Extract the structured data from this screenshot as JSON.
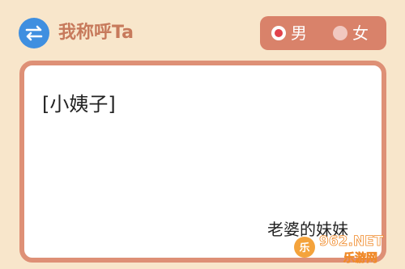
{
  "header": {
    "title": "我称呼Ta",
    "swap_icon": "swap-icon",
    "accent": "#3f8fe0"
  },
  "gender": {
    "options": [
      {
        "label": "男",
        "selected": true
      },
      {
        "label": "女",
        "selected": false
      }
    ],
    "accent": "#d9826a"
  },
  "result": {
    "term": "[小姨子]",
    "relation": "老婆的妹妹"
  },
  "watermark": {
    "text_top": "962.NET",
    "text_bottom": "乐游网"
  }
}
